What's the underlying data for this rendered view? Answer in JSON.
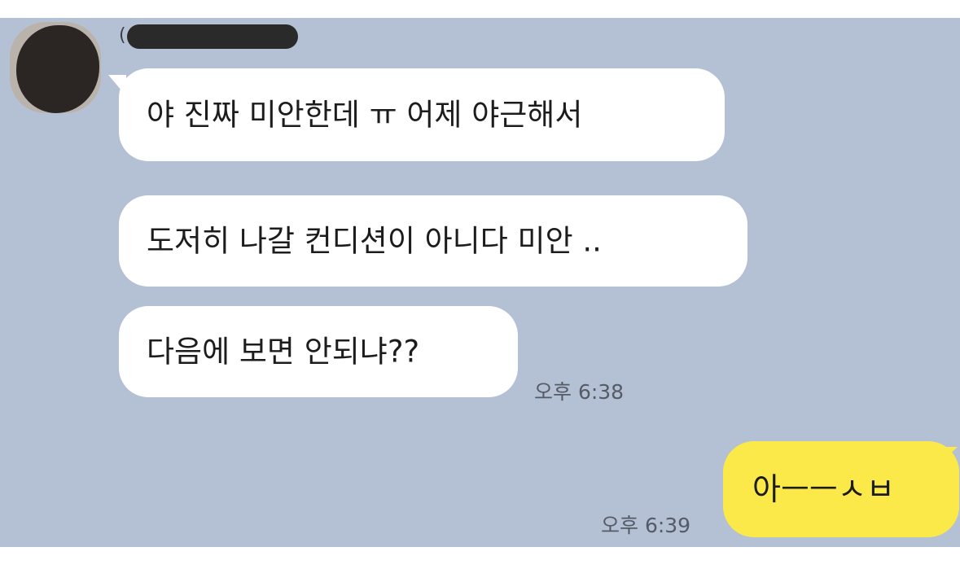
{
  "chat": {
    "background_color": "#b4c0d3",
    "sender": {
      "name_visible_fragment": "(",
      "avatar_icon": "profile-avatar-redacted",
      "name_redacted": true
    },
    "messages": [
      {
        "from": "other",
        "text": "야 진짜 미안한데 ㅠ 어제 야근해서"
      },
      {
        "from": "other",
        "text": "도저히 나갈 컨디션이 아니다 미안 .."
      },
      {
        "from": "other",
        "text": "다음에 보면 안되냐??",
        "time": "오후 6:38"
      },
      {
        "from": "me",
        "text": "아ㅡㅡㅅㅂ",
        "time": "오후 6:39"
      }
    ],
    "bubble_color_other": "#ffffff",
    "bubble_color_me": "#fbe94a"
  }
}
